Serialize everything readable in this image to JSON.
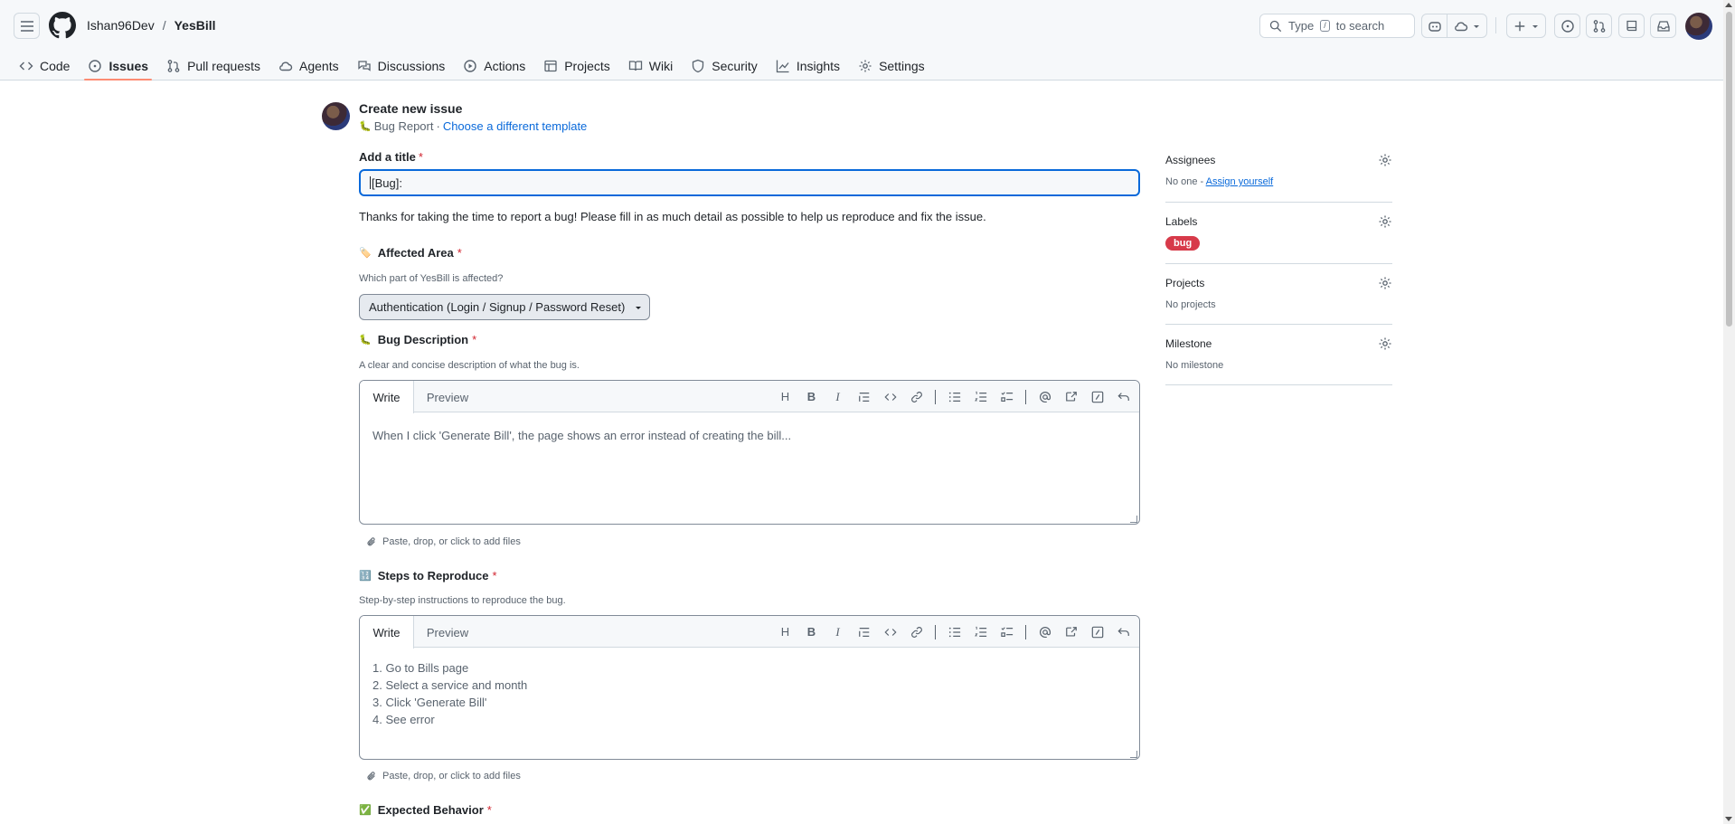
{
  "header": {
    "owner": "Ishan96Dev",
    "separator": "/",
    "repo": "YesBill",
    "search_prefix": "Type",
    "search_key": "/",
    "search_suffix": "to search"
  },
  "nav": {
    "items": [
      {
        "label": "Code",
        "icon": "code-icon"
      },
      {
        "label": "Issues",
        "icon": "issue-opened-icon",
        "active": true
      },
      {
        "label": "Pull requests",
        "icon": "git-pull-request-icon"
      },
      {
        "label": "Agents",
        "icon": "agent-icon"
      },
      {
        "label": "Discussions",
        "icon": "comment-discussion-icon"
      },
      {
        "label": "Actions",
        "icon": "play-icon"
      },
      {
        "label": "Projects",
        "icon": "table-icon"
      },
      {
        "label": "Wiki",
        "icon": "book-icon"
      },
      {
        "label": "Security",
        "icon": "shield-icon"
      },
      {
        "label": "Insights",
        "icon": "graph-icon"
      },
      {
        "label": "Settings",
        "icon": "gear-icon"
      }
    ]
  },
  "page": {
    "title": "Create new issue",
    "template_name": "Bug Report",
    "template_sep": "·",
    "template_link": "Choose a different template"
  },
  "form": {
    "title_label": "Add a title",
    "required_mark": "*",
    "title_value": "[Bug]: ",
    "intro": "Thanks for taking the time to report a bug! Please fill in as much detail as possible to help us reproduce and fix the issue.",
    "affected_area": {
      "label": "Affected Area",
      "emoji": "🏷️",
      "help": "Which part of YesBill is affected?",
      "selected": "Authentication (Login / Signup / Password Reset)"
    },
    "bug_description": {
      "label": "Bug Description",
      "emoji": "🐛",
      "help": "A clear and concise description of what the bug is.",
      "placeholder_lines": [
        "When I click 'Generate Bill', the page shows an error instead of creating the bill..."
      ]
    },
    "steps": {
      "label": "Steps to Reproduce",
      "emoji": "🔢",
      "help": "Step-by-step instructions to reproduce the bug.",
      "placeholder_lines": [
        "1. Go to Bills page",
        "2. Select a service and month",
        "3. Click 'Generate Bill'",
        "4. See error"
      ]
    },
    "expected": {
      "label": "Expected Behavior",
      "emoji": "✅"
    },
    "editor_tabs": {
      "write": "Write",
      "preview": "Preview"
    },
    "toolbar_heading": "H",
    "toolbar_bold": "B",
    "toolbar_italic": "I",
    "attach_text": "Paste, drop, or click to add files"
  },
  "sidebar": {
    "assignees": {
      "label": "Assignees",
      "value_prefix": "No one - ",
      "value_link": "Assign yourself"
    },
    "labels": {
      "label": "Labels",
      "bug_label": "bug",
      "bug_color": "#d73a4a"
    },
    "projects": {
      "label": "Projects",
      "value": "No projects"
    },
    "milestone": {
      "label": "Milestone",
      "value": "No milestone"
    }
  },
  "colors": {
    "accent": "#0969da",
    "nav_underline": "#fd8c73",
    "required": "#d1242f"
  }
}
